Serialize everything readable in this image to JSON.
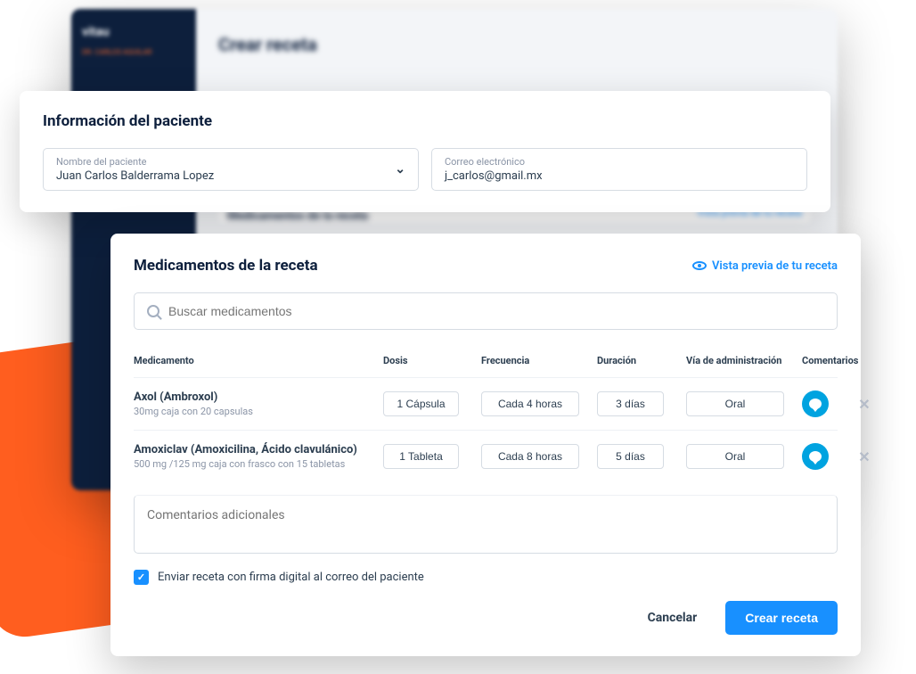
{
  "bg": {
    "logo": "vitau",
    "user": "DR. CARLOS AGUILAR",
    "title": "Crear receta",
    "section": "Medicamentos de la receta",
    "link": "Vista previa de tu receta"
  },
  "patient": {
    "title": "Información del paciente",
    "name_label": "Nombre del paciente",
    "name_value": "Juan Carlos Balderrama Lopez",
    "email_label": "Correo electrónico",
    "email_value": "j_carlos@gmail.mx"
  },
  "meds": {
    "title": "Medicamentos de la receta",
    "preview_link": "Vista previa de tu receta",
    "search_placeholder": "Buscar medicamentos",
    "headers": {
      "medication": "Medicamento",
      "dose": "Dosis",
      "frequency": "Frecuencia",
      "duration": "Duración",
      "route": "Vía de administración",
      "comments": "Comentarios"
    },
    "rows": [
      {
        "name": "Axol (Ambroxol)",
        "desc": "30mg caja con 20 capsulas",
        "dose": "1 Cápsula",
        "frequency": "Cada 4 horas",
        "duration": "3 días",
        "route": "Oral"
      },
      {
        "name": "Amoxiclav (Amoxicilina, Ácido clavulánico)",
        "desc": "500 mg /125 mg caja con frasco con 15 tabletas",
        "dose": "1 Tableta",
        "frequency": "Cada 8 horas",
        "duration": "5 días",
        "route": "Oral"
      }
    ],
    "comments_placeholder": "Comentarios adicionales",
    "send_checkbox_label": "Enviar receta con firma digital al correo del paciente",
    "cancel_label": "Cancelar",
    "create_label": "Crear receta"
  }
}
